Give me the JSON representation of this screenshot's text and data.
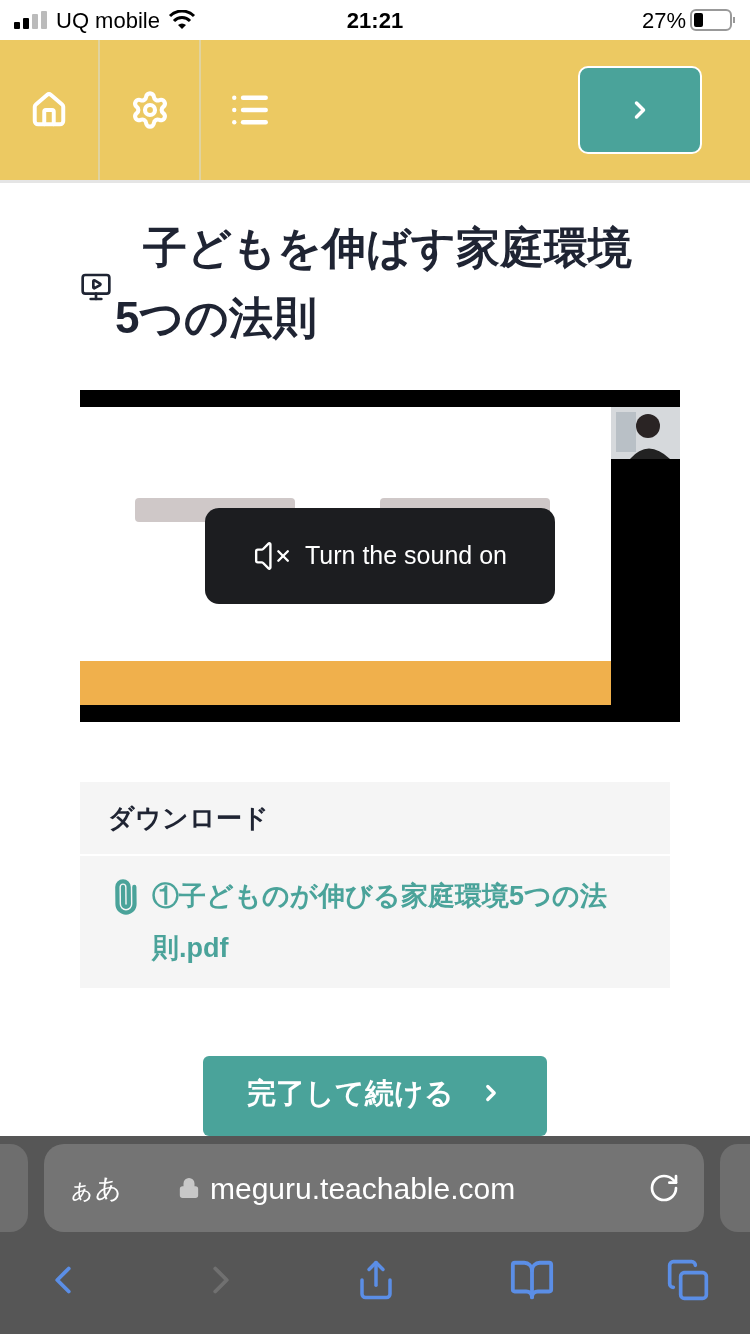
{
  "status_bar": {
    "carrier": "UQ mobile",
    "time": "21:21",
    "battery": "27%"
  },
  "lesson": {
    "title": "子どもを伸ばす家庭環境5つの法則"
  },
  "video": {
    "kind": "picture",
    "sound_prompt": "Turn the sound on"
  },
  "downloads": {
    "heading": "ダウンロード",
    "files": [
      {
        "name": "①子どものが伸びる家庭環境5つの法則.pdf"
      }
    ]
  },
  "complete_button": "完了して続ける",
  "browser": {
    "keyboard_label": "ぁあ",
    "url": "meguru.teachable.com",
    "back_disabled": false,
    "forward_disabled": true
  }
}
